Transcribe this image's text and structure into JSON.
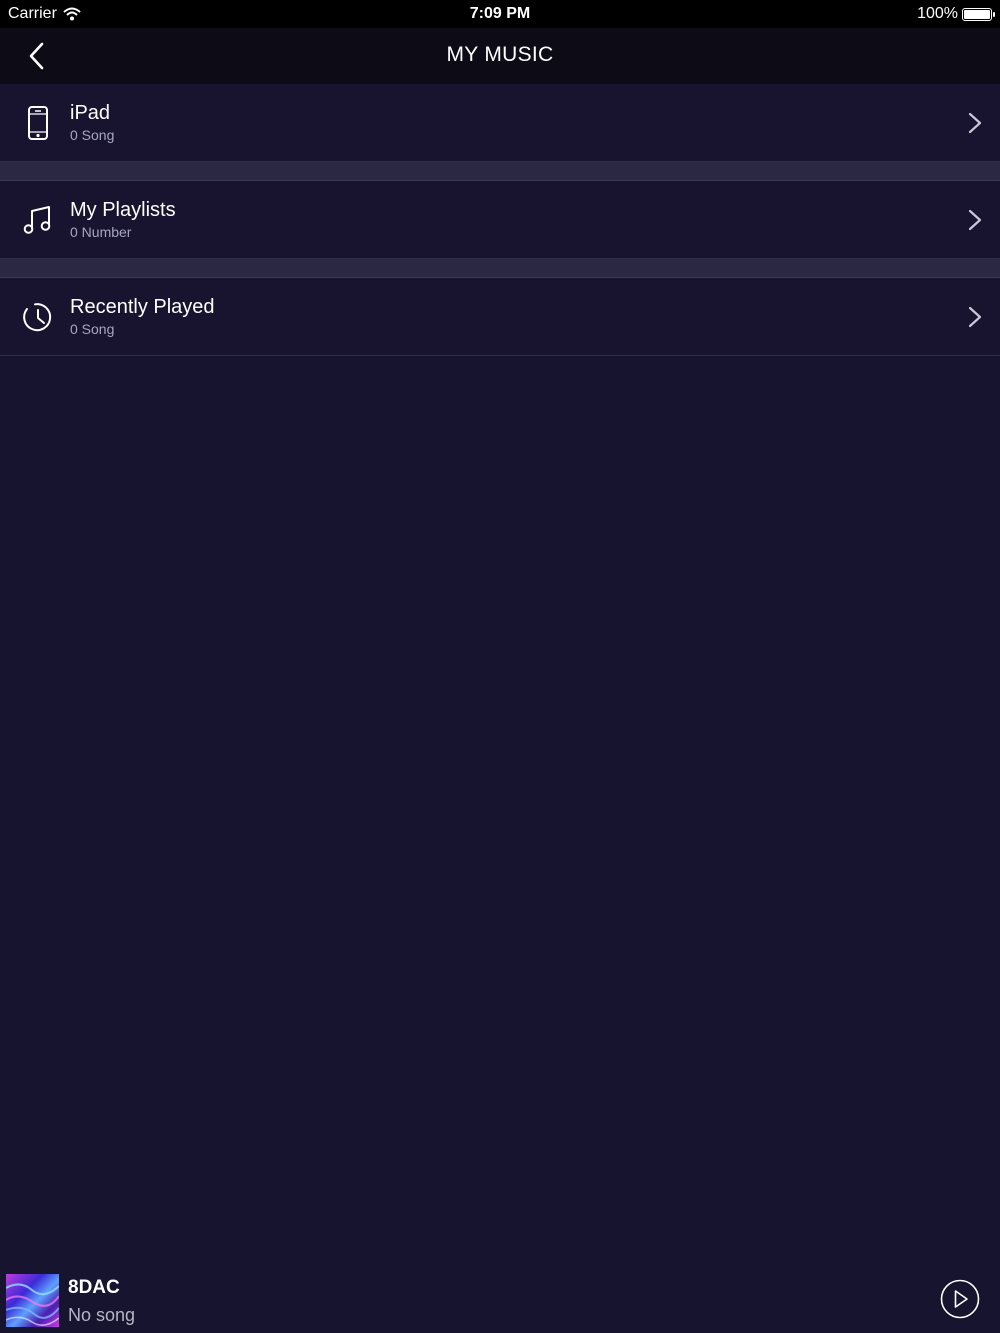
{
  "status_bar": {
    "carrier": "Carrier",
    "time": "7:09 PM",
    "battery": "100%"
  },
  "nav": {
    "title": "MY MUSIC",
    "back_icon": "chevron-left-icon"
  },
  "rows": [
    {
      "label": "iPad",
      "sub": "0 Song",
      "icon": "device-icon"
    },
    {
      "label": "My Playlists",
      "sub": "0 Number",
      "icon": "music-note-icon"
    },
    {
      "label": "Recently Played",
      "sub": "0 Song",
      "icon": "clock-icon"
    }
  ],
  "player": {
    "name": "8DAC",
    "status": "No song",
    "play_icon": "play-icon"
  },
  "colors": {
    "background": "#16142e",
    "row": "#18142f",
    "separator": "#2a2842",
    "nav": "#0c0b16"
  }
}
